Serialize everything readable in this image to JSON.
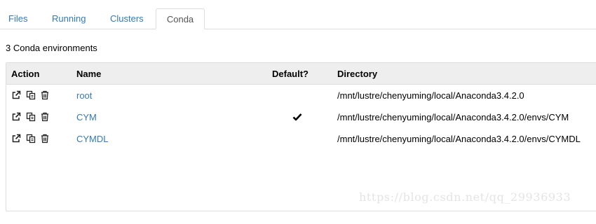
{
  "tabs": [
    {
      "label": "Files"
    },
    {
      "label": "Running"
    },
    {
      "label": "Clusters"
    },
    {
      "label": "Conda",
      "active": true
    }
  ],
  "env_count_text": "3 Conda environments",
  "table": {
    "columns": [
      "Action",
      "Name",
      "Default?",
      "Directory"
    ],
    "rows": [
      {
        "name": "root",
        "default": false,
        "directory": "/mnt/lustre/chenyuming/local/Anaconda3.4.2.0"
      },
      {
        "name": "CYM",
        "default": true,
        "directory": "/mnt/lustre/chenyuming/local/Anaconda3.4.2.0/envs/CYM"
      },
      {
        "name": "CYMDL",
        "default": false,
        "directory": "/mnt/lustre/chenyuming/local/Anaconda3.4.2.0/envs/CYMDL"
      }
    ],
    "action_icons": [
      "external-link-icon",
      "copy-icon",
      "trash-icon"
    ]
  },
  "watermark": "https://blog.csdn.net/qq_29936933",
  "colors": {
    "link": "#337ab7",
    "header_bg": "#eeeeee",
    "border": "#dddddd"
  }
}
